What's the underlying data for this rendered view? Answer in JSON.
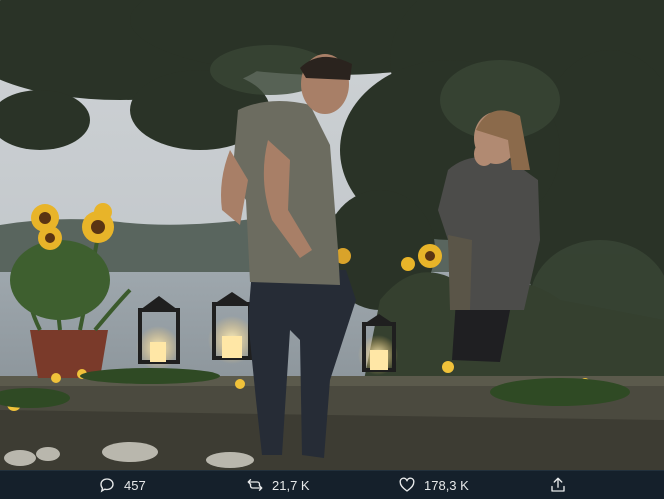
{
  "photo": {
    "alt_icon": "photo"
  },
  "actions": {
    "reply": {
      "icon": "reply-icon",
      "count": "457"
    },
    "retweet": {
      "icon": "retweet-icon",
      "count": "21,7 K"
    },
    "like": {
      "icon": "heart-icon",
      "count": "178,3 K"
    },
    "share": {
      "icon": "share-icon"
    }
  },
  "colors": {
    "bar_background": "#15202b",
    "bar_text": "#e7e9ea"
  }
}
